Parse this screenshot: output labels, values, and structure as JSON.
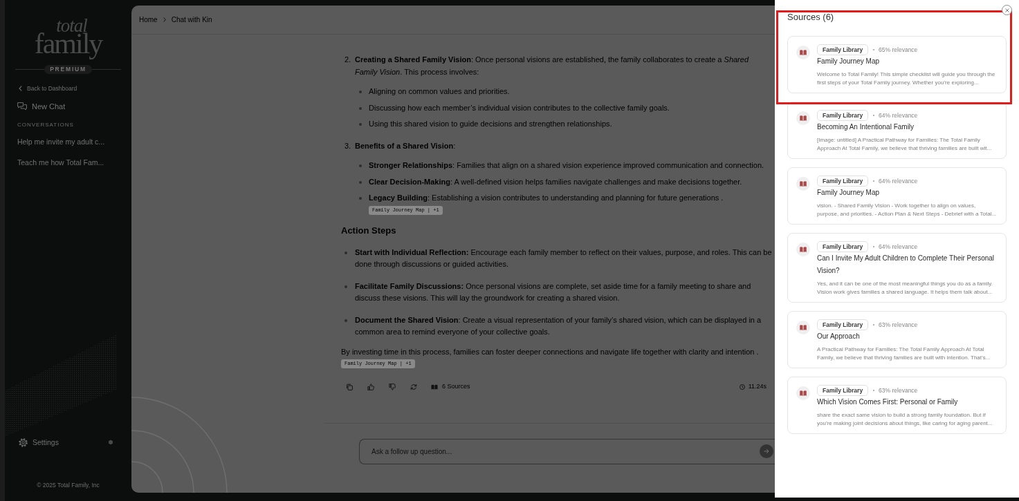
{
  "sidebar": {
    "logo": {
      "line_1": "total",
      "line_2": "family"
    },
    "plan_badge": "PREMIUM",
    "back_link": "Back to Dashboard",
    "new_chat": "New Chat",
    "section_label": "CONVERSATIONS",
    "conversations": [
      {
        "title": "Help me invite my adult c...",
        "selected": false
      },
      {
        "title": "Teach me how Total Fam...",
        "selected": false
      }
    ],
    "settings": "Settings",
    "footer": "© 2025 Total Family, Inc"
  },
  "chat": {
    "breadcrumb": [
      "Home",
      "Chat with Kin"
    ],
    "blocks": [
      {
        "kind": "numbered",
        "number": "2.",
        "text": "**Creating a Shared Family Vision**: Once personal visions are established, the family collaborates to create a *Shared Family Vision*. This process involves:",
        "bullets": [
          "Aligning on common values and priorities.",
          "Discussing how each member’s individual vision contributes to the collective family goals.",
          "Using this shared vision to guide decisions and strengthen relationships."
        ]
      },
      {
        "kind": "numbered",
        "number": "3.",
        "text": "**Benefits of a Shared Vision**:",
        "bullets": [
          "**Stronger Relationships**: Families that align on a shared vision experience improved communication and connection.",
          "**Clear Decision-Making**: A well-defined vision helps families navigate challenges and make decisions together.",
          "**Legacy Building**: Establishing a vision contributes to understanding and planning for future generations ."
        ],
        "citation": "Family Journey Map | +1"
      },
      {
        "kind": "heading",
        "text": "Action Steps"
      },
      {
        "kind": "bullets",
        "bullets": [
          "**Start with Individual Reflection:** Encourage each family member to reflect on their values, purpose, and roles. This can be done through discussions or guided activities.",
          "**Facilitate Family Discussions:** Once personal visions are complete, set aside time for a family meeting to share and discuss these visions. This will lay the groundwork for creating a shared vision.",
          "**Document the Shared Vision**: Create a visual representation of your family’s shared vision, which can be displayed in a common area to remind everyone of your collective goals."
        ]
      },
      {
        "kind": "paragraph",
        "text": "By investing time in this process, families can foster deeper connections and navigate life together with clarity and intention .",
        "citation": "Family Journey Map | +1"
      }
    ],
    "sources_button": "6 Sources",
    "response_time": "11.24s",
    "input": {
      "placeholder": "Ask a follow up question..."
    }
  },
  "sources_panel": {
    "title": "Sources (6)",
    "highlight_frame": true,
    "items": [
      {
        "tag": "Family Library",
        "relevance": "65% relevance",
        "title": "Family Journey Map",
        "snippet": "Welcome to Total Family! This simple checklist will guide you through the first steps of your Total Family journey. Whether you’re exploring..."
      },
      {
        "tag": "Family Library",
        "relevance": "64% relevance",
        "title": "Becoming An Intentional Family",
        "snippet": "[Image: untitled] A Practical Pathway for Families: The Total Family Approach At Total Family, we believe that thriving families are built wit..."
      },
      {
        "tag": "Family Library",
        "relevance": "64% relevance",
        "title": "Family Journey Map",
        "snippet": "vision. - Shared Family Vision - Work together to align on values, purpose, and priorities. - Action Plan & Next Steps - Debrief with a Total..."
      },
      {
        "tag": "Family Library",
        "relevance": "64% relevance",
        "title": "Can I Invite My Adult Children to Complete Their Personal Vision?",
        "snippet": "Yes, and it can be one of the most meaningful things you do as a family. Vision work gives families a shared language. It helps them talk about..."
      },
      {
        "tag": "Family Library",
        "relevance": "63% relevance",
        "title": "Our Approach",
        "snippet": "A Practical Pathway for Families: The Total Family Approach At Total Family, we believe that thriving families are built with intention. That’s..."
      },
      {
        "tag": "Family Library",
        "relevance": "63% relevance",
        "title": "Which Vision Comes First: Personal or Family",
        "snippet": "share the exact same vision to build a strong family foundation. But if you’re making joint decisions about things, like caring for aging parent..."
      }
    ]
  }
}
